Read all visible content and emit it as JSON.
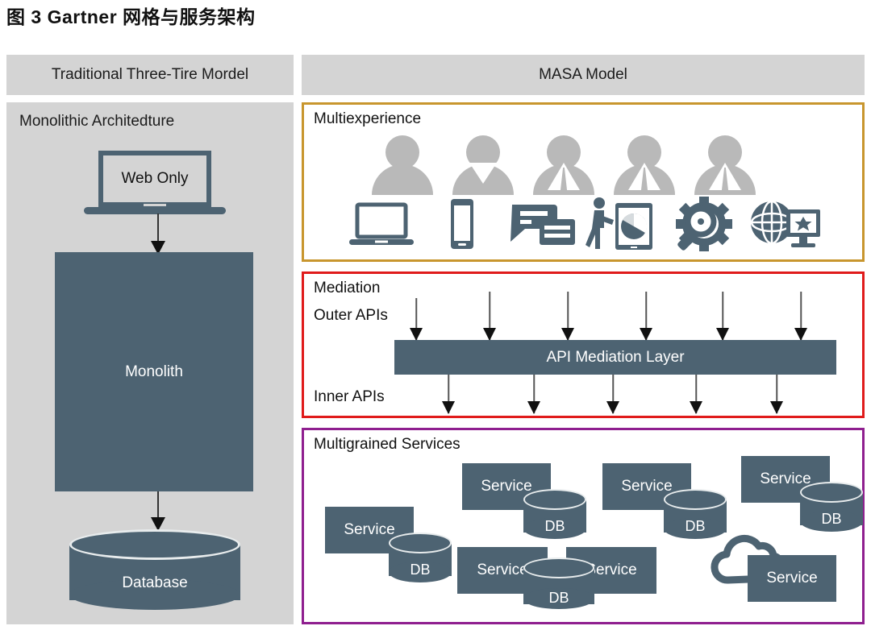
{
  "figure": {
    "title": "图 3  Gartner 网格与服务架构"
  },
  "colors": {
    "slate": "#4d6372",
    "panel_gray": "#d4d4d4",
    "header_gray": "#d4d4d4",
    "multiexperience_border": "#c8962e",
    "mediation_border": "#e01b1b",
    "services_border": "#8f1f8f",
    "persona_gray": "#b9b9b9"
  },
  "headers": {
    "left": "Traditional Three-Tire Mordel",
    "right": "MASA Model"
  },
  "left_column": {
    "title": "Monolithic Architedture",
    "laptop_label": "Web Only",
    "monolith_label": "Monolith",
    "database_label": "Database",
    "laptop_icon": "laptop-icon",
    "database_icon": "database-cylinder-icon"
  },
  "multiexperience": {
    "title": "Multiexperience",
    "personas": [
      {
        "name": "persona-plain-1",
        "style": "plain"
      },
      {
        "name": "persona-vneck-2",
        "style": "vneck"
      },
      {
        "name": "persona-suit-3",
        "style": "suit"
      },
      {
        "name": "persona-suit-4",
        "style": "suit"
      },
      {
        "name": "persona-suit-5",
        "style": "suit"
      }
    ],
    "devices": [
      {
        "name": "laptop-icon"
      },
      {
        "name": "mobile-phone-icon"
      },
      {
        "name": "chat-bubbles-icon"
      },
      {
        "name": "person-analytics-tablet-icon"
      },
      {
        "name": "gear-magnifier-icon"
      },
      {
        "name": "globe-monitor-icon"
      }
    ]
  },
  "mediation": {
    "title": "Mediation",
    "outer_apis_label": "Outer APIs",
    "inner_apis_label": "Inner APIs",
    "layer_label": "API Mediation Layer",
    "outer_arrow_count": 6,
    "inner_arrow_count": 5
  },
  "services": {
    "title": "Multigrained Services",
    "service_label": "Service",
    "db_label": "DB",
    "nodes": [
      {
        "name": "service-node-1",
        "service": "Service",
        "db": "DB"
      },
      {
        "name": "service-node-2",
        "service": "Service",
        "db": "DB"
      },
      {
        "name": "service-node-3",
        "service": "Service",
        "db": "DB"
      },
      {
        "name": "service-node-4",
        "service": "Service",
        "db": "DB"
      },
      {
        "name": "service-node-5",
        "service": "Service",
        "db": "DB"
      },
      {
        "name": "service-node-6",
        "service": "Service",
        "db": ""
      }
    ],
    "cloud_icon": "cloud-icon"
  }
}
